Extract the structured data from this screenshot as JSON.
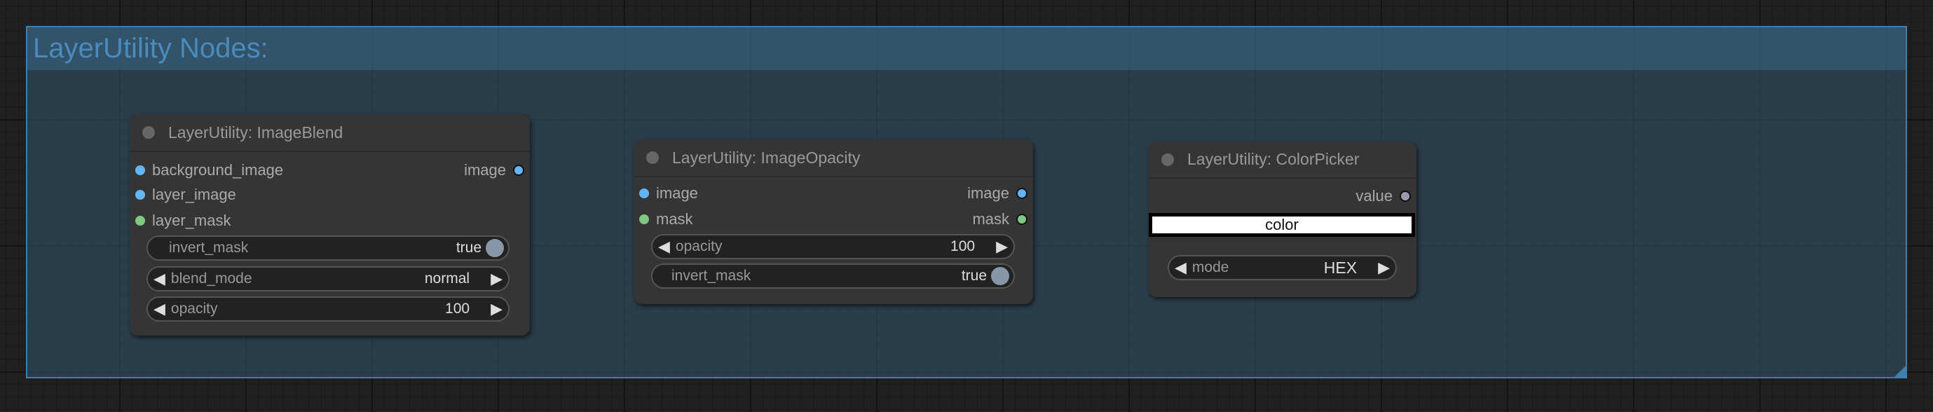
{
  "group": {
    "title": "LayerUtility Nodes:",
    "color": "#3f7fae"
  },
  "colors": {
    "image_slot": "#64b5f6",
    "mask_slot": "#81c784",
    "value_slot": "#9a9ab0"
  },
  "nodes": [
    {
      "title": "LayerUtility: ImageBlend",
      "inputs": [
        "background_image",
        "layer_image",
        "layer_mask"
      ],
      "outputs": [
        "image"
      ],
      "widgets": [
        {
          "label": "invert_mask",
          "value": "true",
          "type": "toggle"
        },
        {
          "label": "blend_mode",
          "value": "normal",
          "type": "combo"
        },
        {
          "label": "opacity",
          "value": "100",
          "type": "number"
        }
      ]
    },
    {
      "title": "LayerUtility: ImageOpacity",
      "inputs": [
        "image",
        "mask"
      ],
      "outputs": [
        "image",
        "mask"
      ],
      "widgets": [
        {
          "label": "opacity",
          "value": "100",
          "type": "number"
        },
        {
          "label": "invert_mask",
          "value": "true",
          "type": "toggle"
        }
      ]
    },
    {
      "title": "LayerUtility: ColorPicker",
      "outputs": [
        "value"
      ],
      "color_button": "color",
      "widgets": [
        {
          "label": "mode",
          "value": "HEX",
          "type": "combo"
        }
      ]
    }
  ]
}
